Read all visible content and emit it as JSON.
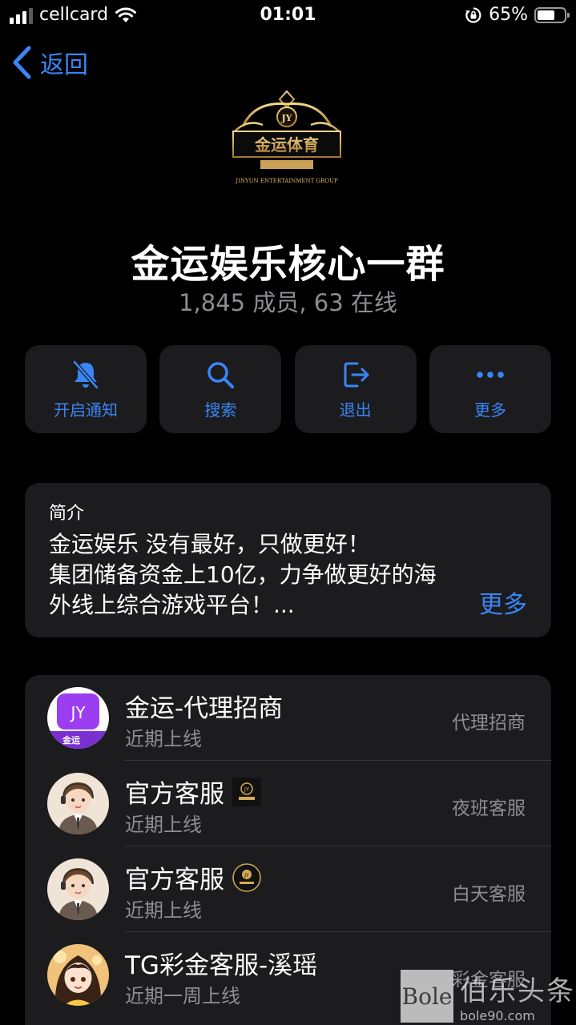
{
  "status_bar": {
    "carrier": "cellcard",
    "time": "01:01",
    "battery": "65%",
    "battery_level": 0.65
  },
  "nav": {
    "back_label": "返回"
  },
  "group": {
    "logo_text": "金运体育",
    "logo_sub": "JINYUN ENTERTAINMENT GROUP",
    "title": "金运娱乐核心一群",
    "subtitle": "1,845 成员, 63 在线"
  },
  "actions": [
    {
      "label": "开启通知",
      "icon": "bell-slash-icon"
    },
    {
      "label": "搜索",
      "icon": "search-icon"
    },
    {
      "label": "退出",
      "icon": "exit-icon"
    },
    {
      "label": "更多",
      "icon": "more-dots-icon"
    }
  ],
  "intro": {
    "heading": "简介",
    "body": "金运娱乐  没有最好，只做更好！\n集团储备资金上10亿，力争做更好的海\n外线上综合游戏平台！...",
    "more_label": "更多"
  },
  "members": [
    {
      "name": "金运-代理招商",
      "status": "近期上线",
      "role": "代理招商",
      "avatar": "jy-purple-logo"
    },
    {
      "name": "官方客服",
      "status": "近期上线",
      "role": "夜班客服",
      "avatar": "support-girl",
      "badge": "jy-badge-square"
    },
    {
      "name": "官方客服",
      "status": "近期上线",
      "role": "白天客服",
      "avatar": "support-girl",
      "badge": "jy-badge-round"
    },
    {
      "name": "TG彩金客服-溪瑶",
      "status": "近期一周上线",
      "role": "彩金客服",
      "avatar": "anime-girl"
    }
  ],
  "watermark": {
    "box": "Bole",
    "text": "伯乐头条",
    "url": "bole90.com"
  },
  "colors": {
    "accent": "#3a86f7",
    "card": "#1c1c1e",
    "secondary_text": "#8d8d92"
  }
}
